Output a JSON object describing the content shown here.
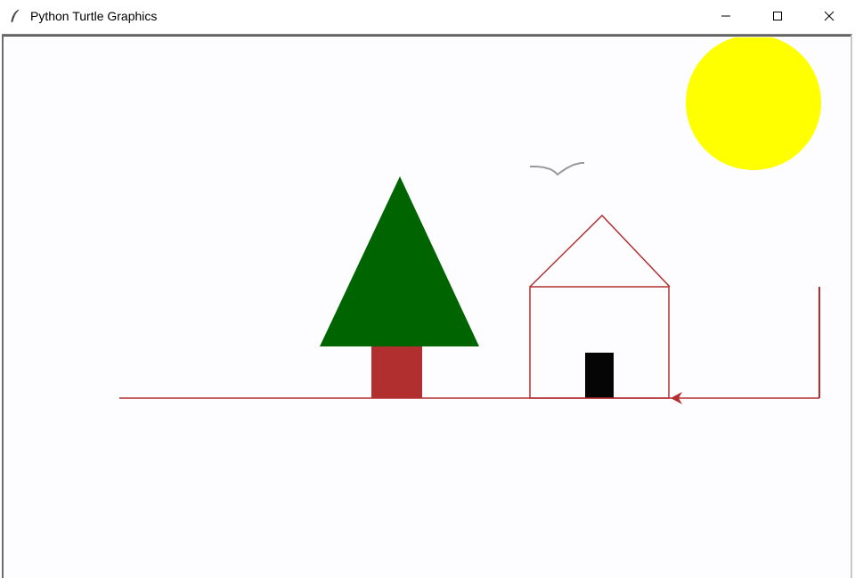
{
  "window": {
    "title": "Python Turtle Graphics",
    "icon": "feather-icon",
    "controls": [
      "minimize-icon",
      "maximize-icon",
      "close-icon"
    ]
  },
  "scene": {
    "colors": {
      "tree_foliage": "#006400",
      "tree_trunk": "#b22f30",
      "house_outline": "#b22f30",
      "door": "#050505",
      "ground_line": "#b22f30",
      "sun": "#ffff00",
      "bird": "#9a9a9a",
      "turtle_cursor": "#b22f30"
    }
  }
}
